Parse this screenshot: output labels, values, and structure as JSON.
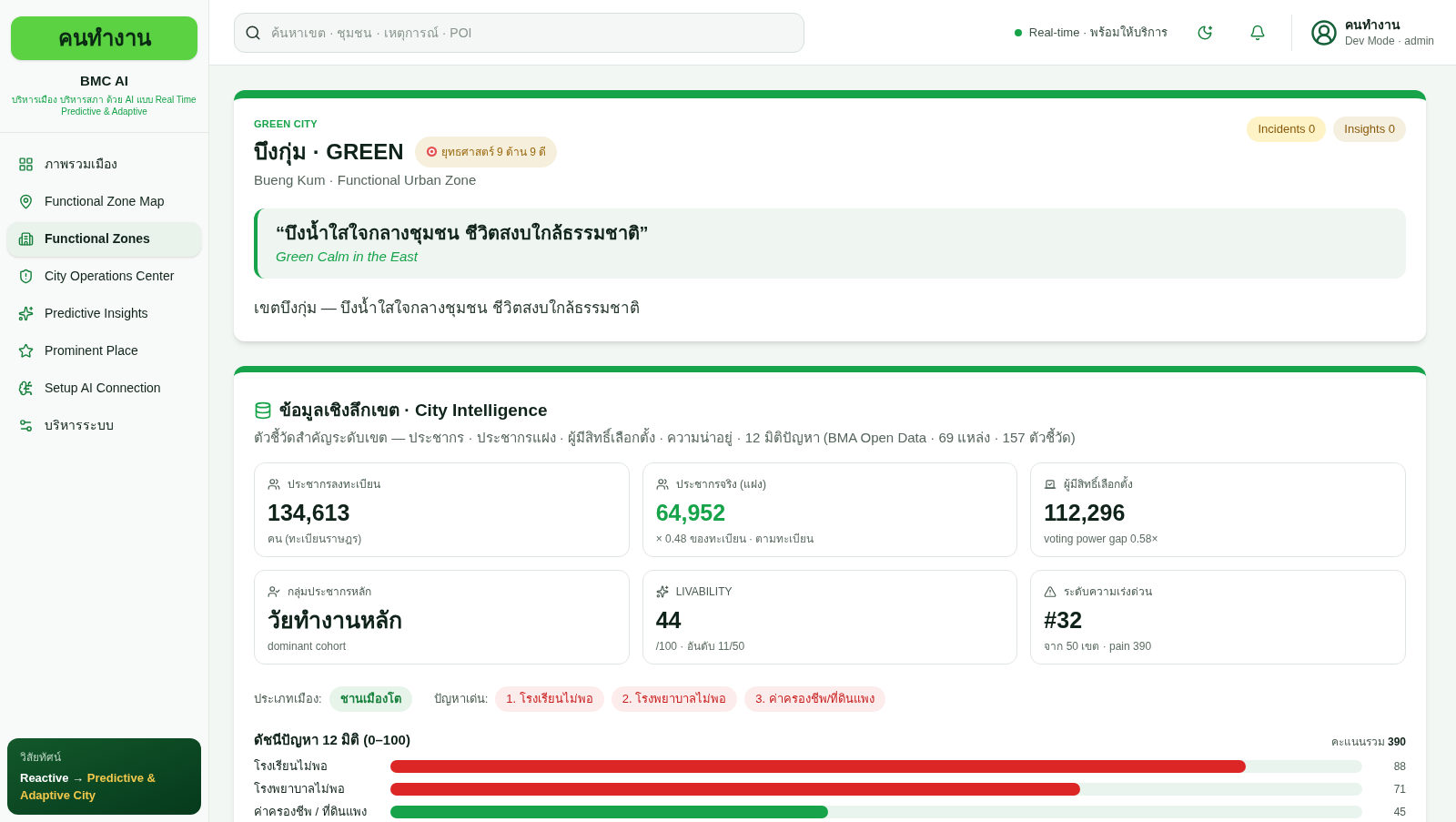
{
  "sidebar": {
    "logo": "คนทำงาน",
    "brand": "BMC AI",
    "tagline": "บริหารเมือง บริหารสภา ด้วย AI แบบ Real Time Predictive & Adaptive",
    "items": [
      {
        "kind": "overview",
        "label": "ภาพรวมเมือง",
        "selected": false
      },
      {
        "kind": "map",
        "label": "Functional Zone Map",
        "selected": false
      },
      {
        "kind": "zones",
        "label": "Functional Zones",
        "selected": true
      },
      {
        "kind": "operations",
        "label": "City Operations Center",
        "selected": false
      },
      {
        "kind": "insights",
        "label": "Predictive Insights",
        "selected": false
      },
      {
        "kind": "places",
        "label": "Prominent Place",
        "selected": false
      },
      {
        "kind": "ai",
        "label": "Setup AI Connection",
        "selected": false
      },
      {
        "kind": "admin",
        "label": "บริหารระบบ",
        "selected": false
      }
    ],
    "vision": {
      "label": "วิสัยทัศน์",
      "from": "Reactive",
      "arrow": "→",
      "to": "Predictive & Adaptive City"
    }
  },
  "header": {
    "search": {
      "placeholder": "ค้นหาเขต · ชุมชน · เหตุการณ์ · POI"
    },
    "status": {
      "online": true,
      "text": "Real-time · พร้อมให้บริการ"
    },
    "user": {
      "name": "คนทำงาน",
      "role": "Dev Mode · admin"
    }
  },
  "zone": {
    "eyebrow": "GREEN CITY",
    "title": "บึงกุ่ม · GREEN",
    "badge": "ยุทธศาสตร์ 9 ด้าน 9 ดี",
    "subtitle": "Bueng Kum · Functional Urban Zone",
    "counters": [
      {
        "label": "Incidents 0",
        "color": "#fef3c7"
      },
      {
        "label": "Insights 0",
        "color": "#f5efe0"
      }
    ],
    "quote": "“บึงน้ำใสใจกลางชุมชน ชีวิตสงบใกล้ธรรมชาติ”",
    "quote_en": "Green Calm in the East",
    "description": "เขตบึงกุ่ม — บึงน้ำใสใจกลางชุมชน ชีวิตสงบใกล้ธรรมชาติ"
  },
  "intel": {
    "title": "ข้อมูลเชิงลึกเขต · City Intelligence",
    "subtitle": "ตัวชี้วัดสำคัญระดับเขต — ประชากร · ประชากรแฝง · ผู้มีสิทธิ์เลือกตั้ง · ความน่าอยู่ · 12 มิติปัญหา (BMA Open Data · 69 แหล่ง · 157 ตัวชี้วัด)",
    "stats": [
      {
        "kind": "population",
        "label": "ประชากรลงทะเบียน",
        "value": "134,613",
        "note": "คน (ทะเบียนราษฎร)",
        "highlight": false
      },
      {
        "kind": "population",
        "label": "ประชากรจริง (แฝง)",
        "value": "64,952",
        "note": "× 0.48 ของทะเบียน · ตามทะเบียน",
        "highlight": true
      },
      {
        "kind": "voters",
        "label": "ผู้มีสิทธิ์เลือกตั้ง",
        "value": "112,296",
        "note": "voting power gap 0.58×",
        "highlight": false
      },
      {
        "kind": "cohort",
        "label": "กลุ่มประชากรหลัก",
        "value": "วัยทำงานหลัก",
        "note": "dominant cohort",
        "highlight": false
      },
      {
        "kind": "livability",
        "label": "LIVABILITY",
        "value": "44",
        "note": "/100 · อันดับ 11/50",
        "highlight": false
      },
      {
        "kind": "urgency",
        "label": "ระดับความเร่งด่วน",
        "value": "#32",
        "note": "จาก 50 เขต · pain 390",
        "highlight": false
      }
    ],
    "city_type": {
      "label": "ประเภทเมือง:",
      "value": "ชานเมืองโต"
    },
    "problems": {
      "label": "ปัญหาเด่น:",
      "items": [
        "1. โรงเรียนไม่พอ",
        "2. โรงพยาบาลไม่พอ",
        "3. ค่าครองชีพ/ที่ดินแพง"
      ]
    },
    "index": {
      "title": "ดัชนีปัญหา 12 มิติ (0–100)",
      "total_label": "คะแนนรวม",
      "total": "390",
      "rows": [
        {
          "label": "โรงเรียนไม่พอ",
          "level": 0.88,
          "value": "88",
          "color": "#dc2626"
        },
        {
          "label": "โรงพยาบาลไม่พอ",
          "level": 0.71,
          "value": "71",
          "color": "#dc2626"
        },
        {
          "label": "ค่าครองชีพ / ที่ดินแพง",
          "level": 0.45,
          "value": "45",
          "color": "#16a34a"
        }
      ]
    }
  }
}
